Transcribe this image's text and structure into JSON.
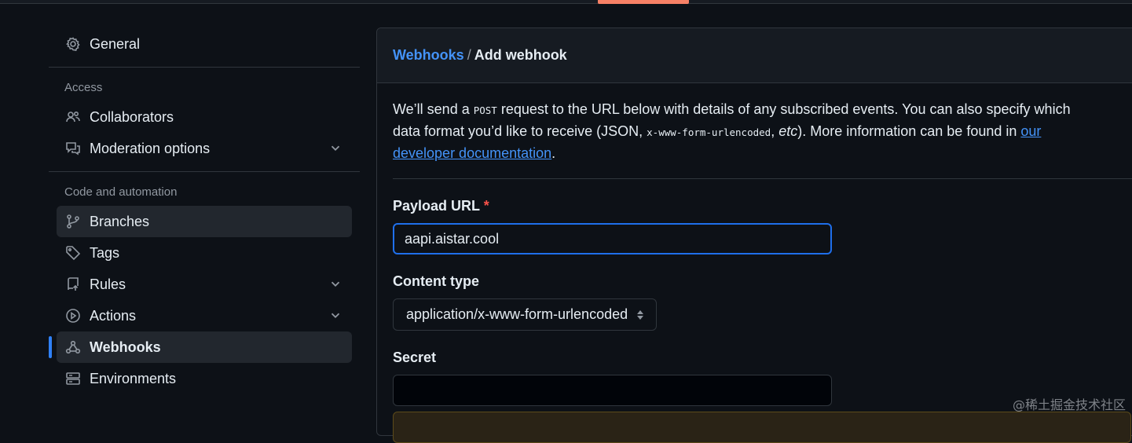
{
  "sidebar": {
    "general": "General",
    "access_label": "Access",
    "collaborators": "Collaborators",
    "moderation": "Moderation options",
    "code_label": "Code and automation",
    "branches": "Branches",
    "tags": "Tags",
    "rules": "Rules",
    "actions": "Actions",
    "webhooks": "Webhooks",
    "environments": "Environments"
  },
  "breadcrumb": {
    "parent": "Webhooks",
    "separator": "/",
    "current": "Add webhook"
  },
  "intro": {
    "part1": "We’ll send a ",
    "post": "POST",
    "part2": " request to the URL below with details of any subscribed events. You can also specify which data format you’d like to receive (JSON, ",
    "urlencoded": "x-www-form-urlencoded",
    "part3": ", ",
    "etc": "etc",
    "part4": "). More information can be found in ",
    "link": "our developer documentation",
    "part5": "."
  },
  "form": {
    "payload_label": "Payload URL",
    "required_mark": "*",
    "payload_value": "aapi.aistar.cool",
    "content_type_label": "Content type",
    "content_type_value": "application/x-www-form-urlencoded",
    "secret_label": "Secret",
    "secret_value": ""
  },
  "watermark": "@稀土掘金技术社区",
  "colors": {
    "background": "#0d1117",
    "accent": "#2f81f7",
    "link": "#4493f8",
    "required": "#f85149",
    "tab_underline": "#f78166"
  }
}
